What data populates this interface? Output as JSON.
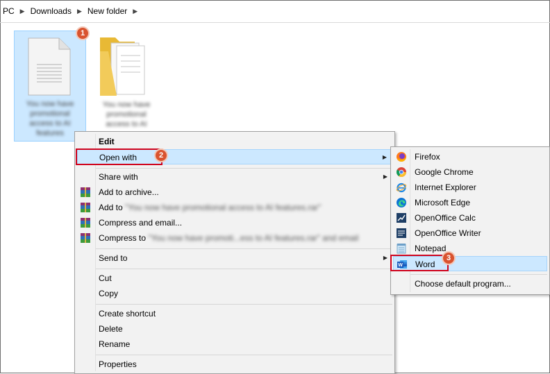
{
  "breadcrumb": [
    "PC",
    "Downloads",
    "New folder"
  ],
  "files": [
    {
      "name": "You now have promotional access to AI features"
    },
    {
      "name": "You now have promotional access to AI"
    }
  ],
  "context_menu": {
    "edit": "Edit",
    "open_with": "Open with",
    "share_with": "Share with",
    "add_to_archive": "Add to archive...",
    "add_to_rar_prefix": "Add to ",
    "add_to_rar_name": "\"You now have promotional access to AI features.rar\"",
    "compress_email": "Compress and email...",
    "compress_to_prefix": "Compress to ",
    "compress_to_name": "\"You now have promoti...ess to AI features.rar\" and email",
    "send_to": "Send to",
    "cut": "Cut",
    "copy": "Copy",
    "create_shortcut": "Create shortcut",
    "delete": "Delete",
    "rename": "Rename",
    "properties": "Properties"
  },
  "open_with_menu": {
    "firefox": "Firefox",
    "chrome": "Google Chrome",
    "ie": "Internet Explorer",
    "edge": "Microsoft Edge",
    "calc": "OpenOffice Calc",
    "writer": "OpenOffice Writer",
    "notepad": "Notepad",
    "word": "Word",
    "choose_default": "Choose default program..."
  },
  "steps": [
    "1",
    "2",
    "3"
  ],
  "colors": {
    "selection": "#cce8ff",
    "highlight_border": "#d0021b",
    "badge": "#d9532f"
  }
}
